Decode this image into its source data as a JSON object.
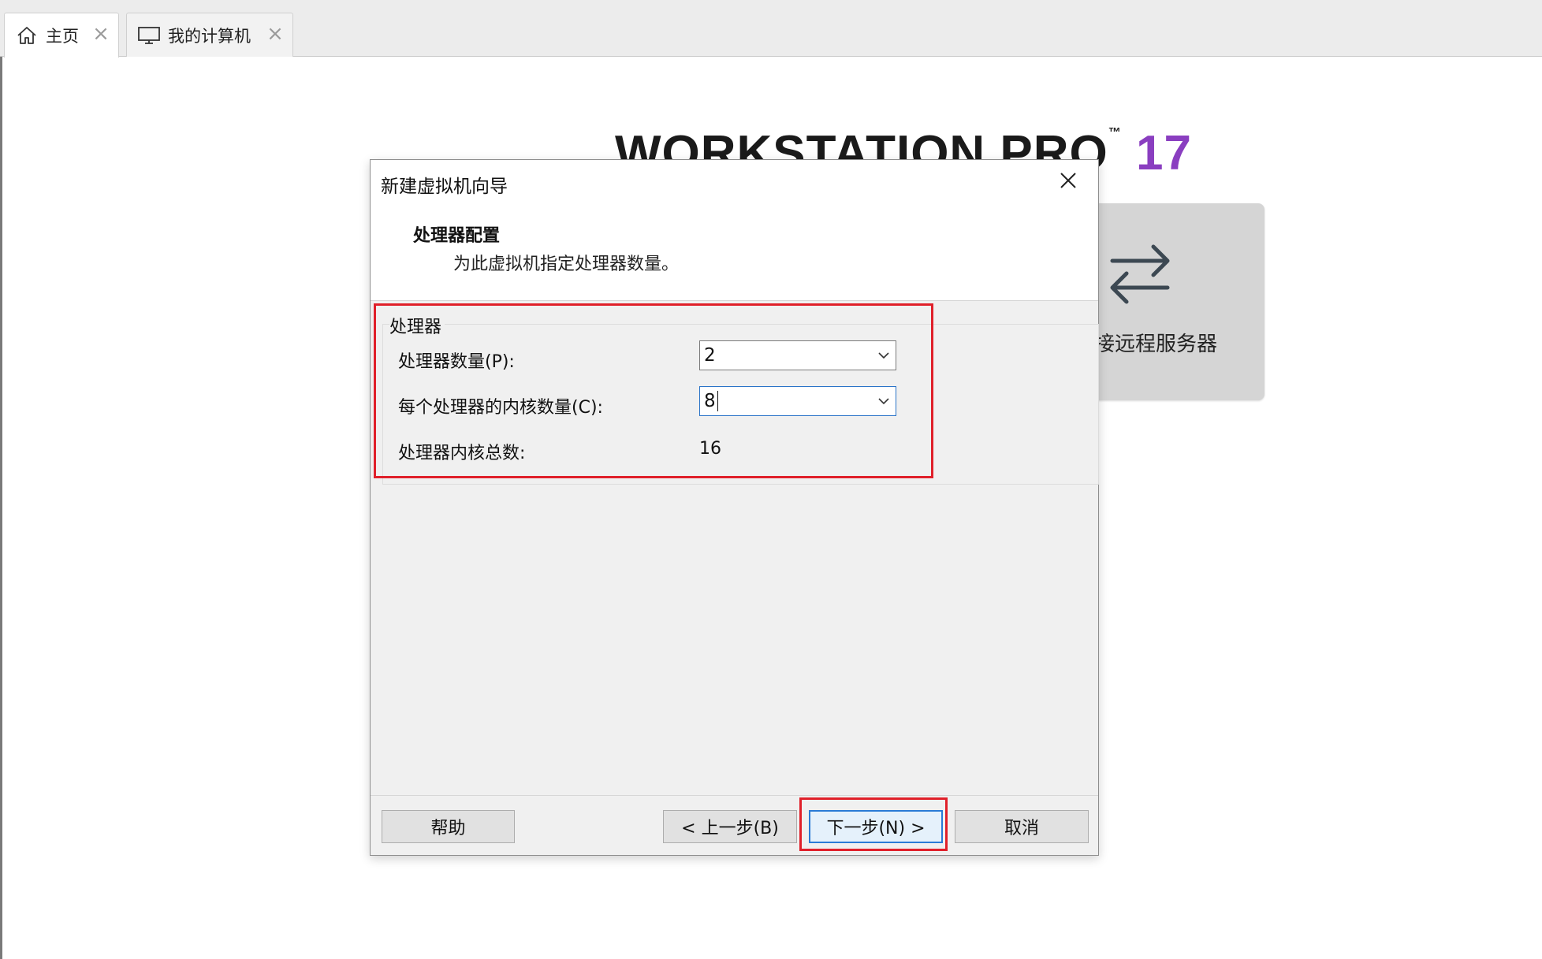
{
  "tabs": [
    {
      "label": "主页",
      "icon": "home-icon",
      "active": true
    },
    {
      "label": "我的计算机",
      "icon": "monitor-icon",
      "active": false
    }
  ],
  "home": {
    "brand_text": "WORKSTATION PRO",
    "brand_tm": "™",
    "brand_version": "17",
    "remote_card_label": "接远程服务器",
    "remote_card_icon": "swap-arrows-icon"
  },
  "dialog": {
    "title": "新建虚拟机向导",
    "header_title": "处理器配置",
    "header_subtitle": "为此虚拟机指定处理器数量。",
    "group_title": "处理器",
    "processor_count_label": "处理器数量(P):",
    "processor_count_value": "2",
    "cores_per_processor_label": "每个处理器的内核数量(C):",
    "cores_per_processor_value": "8",
    "total_cores_label": "处理器内核总数:",
    "total_cores_value": "16",
    "buttons": {
      "help": "帮助",
      "back": "< 上一步(B)",
      "next": "下一步(N) >",
      "cancel": "取消"
    }
  },
  "colors": {
    "accent": "#2a7bd6",
    "brand_version": "#8a3ec0",
    "highlight": "#e0202a"
  }
}
